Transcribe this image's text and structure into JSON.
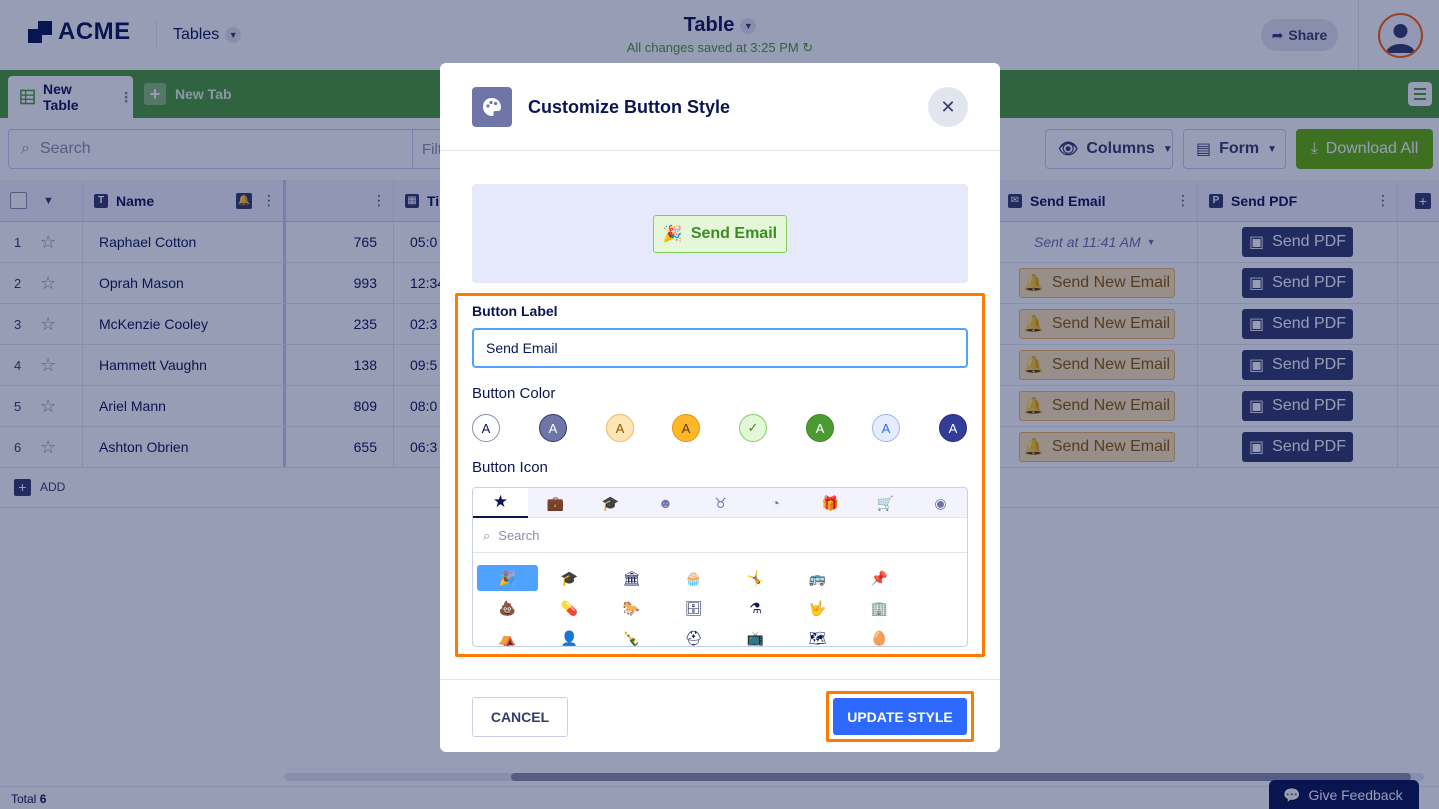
{
  "header": {
    "logo_text": "ACME",
    "app_switch_label": "Tables",
    "doc_title": "Table",
    "save_status": "All changes saved at 3:25 PM",
    "share_label": "Share"
  },
  "tabs": {
    "active_label": "New Table",
    "new_tab_label": "New Tab"
  },
  "toolbar": {
    "search_placeholder": "Search",
    "filter_label": "Filt",
    "columns_label": "Columns",
    "form_label": "Form",
    "download_label": "Download All"
  },
  "grid": {
    "columns": {
      "name": "Name",
      "time_partial": "Ti",
      "send_email": "Send Email",
      "send_pdf": "Send PDF"
    },
    "rows": [
      {
        "num": "1",
        "name": "Raphael Cotton",
        "value": "765",
        "time": "05:0",
        "email": "Sent at 11:41 AM",
        "email_sent": true,
        "pdf": "Send PDF"
      },
      {
        "num": "2",
        "name": "Oprah Mason",
        "value": "993",
        "time": "12:34",
        "email": "Send New Email",
        "email_sent": false,
        "pdf": "Send PDF"
      },
      {
        "num": "3",
        "name": "McKenzie Cooley",
        "value": "235",
        "time": "02:3",
        "email": "Send New Email",
        "email_sent": false,
        "pdf": "Send PDF"
      },
      {
        "num": "4",
        "name": "Hammett Vaughn",
        "value": "138",
        "time": "09:5",
        "email": "Send New Email",
        "email_sent": false,
        "pdf": "Send PDF"
      },
      {
        "num": "5",
        "name": "Ariel Mann",
        "value": "809",
        "time": "08:0",
        "email": "Send New Email",
        "email_sent": false,
        "pdf": "Send PDF"
      },
      {
        "num": "6",
        "name": "Ashton Obrien",
        "value": "655",
        "time": "06:3",
        "email": "Send New Email",
        "email_sent": false,
        "pdf": "Send PDF"
      }
    ],
    "add_label": "ADD"
  },
  "footer": {
    "total_label": "Total",
    "total_count": "6",
    "feedback_label": "Give Feedback"
  },
  "modal": {
    "title": "Customize Button Style",
    "preview_label": "Send Email",
    "button_label_heading": "Button Label",
    "button_label_value": "Send Email",
    "button_color_heading": "Button Color",
    "button_icon_heading": "Button Icon",
    "icon_search_placeholder": "Search",
    "cancel_label": "CANCEL",
    "update_label": "UPDATE STYLE",
    "swatch_letter": "A",
    "swatches": [
      {
        "bg": "#ffffff",
        "fg": "#0a1551",
        "border": "#8d8fa8",
        "selected": false
      },
      {
        "bg": "#6f76a7",
        "fg": "#ffffff",
        "border": "#343c6a",
        "selected": false
      },
      {
        "bg": "#ffe5b4",
        "fg": "#8a5a00",
        "border": "#f0b860",
        "selected": false
      },
      {
        "bg": "#ffb629",
        "fg": "#5a3a00",
        "border": "#e0960a",
        "selected": false
      },
      {
        "bg": "#e4f7d9",
        "fg": "#3d8c22",
        "border": "#7ed05b",
        "selected": true
      },
      {
        "bg": "#4c9b32",
        "fg": "#ffffff",
        "border": "#3d8c22",
        "selected": false
      },
      {
        "bg": "#e6ecff",
        "fg": "#2e69ff",
        "border": "#9fb4f0",
        "selected": false
      },
      {
        "bg": "#343c9a",
        "fg": "#ffffff",
        "border": "#252c7a",
        "selected": false
      }
    ],
    "icon_categories": [
      "★",
      "💼",
      "🎓",
      "☻",
      "♉",
      "◔",
      "🎁",
      "🛒",
      "◉"
    ],
    "icon_glyphs": [
      [
        "🎉",
        "🎓",
        "🏛",
        "🧁",
        "🤸",
        "🚌",
        "📌"
      ],
      [
        "💩",
        "💊",
        "🐎",
        "🗄",
        "⚗",
        "🤟",
        "🏢"
      ],
      [
        "⛺",
        "👤",
        "🍾",
        "⛑",
        "📺",
        "🗺",
        "🥚"
      ]
    ],
    "accent_color": "#2e69ff",
    "highlight_color": "#ff7a00"
  }
}
